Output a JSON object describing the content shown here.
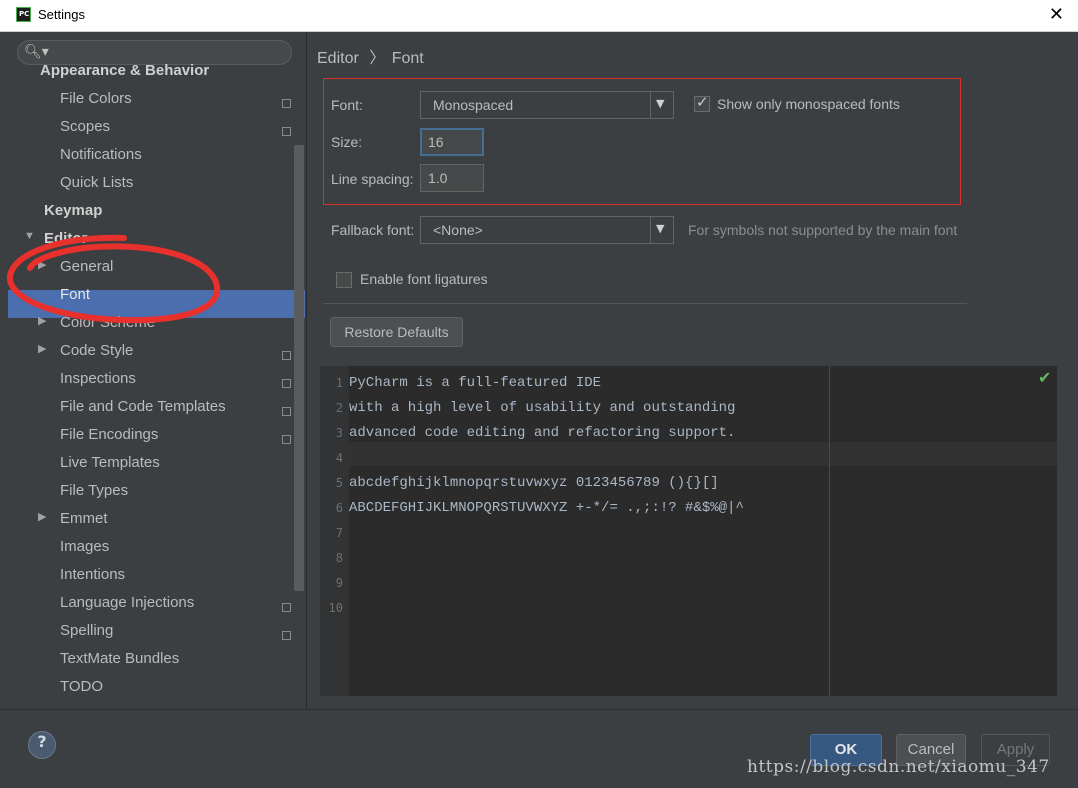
{
  "window": {
    "title": "Settings",
    "close_glyph": "✕",
    "app_icon": "PC"
  },
  "search": {
    "icon": "search-icon",
    "glyph": "🔍︎▾"
  },
  "tree": [
    {
      "label": "Appearance & Behavior",
      "kind": "category"
    },
    {
      "label": "File Colors",
      "kind": "item",
      "copy": true
    },
    {
      "label": "Scopes",
      "kind": "item",
      "copy": true
    },
    {
      "label": "Notifications",
      "kind": "item"
    },
    {
      "label": "Quick Lists",
      "kind": "item"
    },
    {
      "label": "Keymap",
      "kind": "category"
    },
    {
      "label": "Editor",
      "kind": "category",
      "expanded": true
    },
    {
      "label": "General",
      "kind": "item",
      "arrow": true
    },
    {
      "label": "Font",
      "kind": "item",
      "selected": true
    },
    {
      "label": "Color Scheme",
      "kind": "item",
      "arrow": true
    },
    {
      "label": "Code Style",
      "kind": "item",
      "arrow": true,
      "copy": true
    },
    {
      "label": "Inspections",
      "kind": "item",
      "copy": true
    },
    {
      "label": "File and Code Templates",
      "kind": "item",
      "copy": true
    },
    {
      "label": "File Encodings",
      "kind": "item",
      "copy": true
    },
    {
      "label": "Live Templates",
      "kind": "item"
    },
    {
      "label": "File Types",
      "kind": "item"
    },
    {
      "label": "Emmet",
      "kind": "item",
      "arrow": true
    },
    {
      "label": "Images",
      "kind": "item"
    },
    {
      "label": "Intentions",
      "kind": "item"
    },
    {
      "label": "Language Injections",
      "kind": "item",
      "copy": true
    },
    {
      "label": "Spelling",
      "kind": "item",
      "copy": true
    },
    {
      "label": "TextMate Bundles",
      "kind": "item"
    },
    {
      "label": "TODO",
      "kind": "item"
    }
  ],
  "breadcrumb": {
    "parent": "Editor",
    "sep": "〉",
    "current": "Font"
  },
  "font": {
    "font_label": "Font:",
    "font_value": "Monospaced",
    "mono_label": "Show only monospaced fonts",
    "mono_checked": "✓",
    "size_label": "Size:",
    "size_value": "16",
    "spacing_label": "Line spacing:",
    "spacing_value": "1.0",
    "fallback_label": "Fallback font:",
    "fallback_value": "<None>",
    "fallback_hint": "For symbols not supported by the main font",
    "ligatures_label": "Enable font ligatures",
    "restore_label": "Restore Defaults",
    "dropdown_glyph": "▼"
  },
  "preview": {
    "lines": [
      {
        "n": "1",
        "text": "PyCharm is a full-featured IDE"
      },
      {
        "n": "2",
        "text": "with a high level of usability and outstanding"
      },
      {
        "n": "3",
        "text": "advanced code editing and refactoring support."
      },
      {
        "n": "4",
        "text": ""
      },
      {
        "n": "5",
        "text": "abcdefghijklmnopqrstuvwxyz 0123456789 (){}[]"
      },
      {
        "n": "6",
        "text": "ABCDEFGHIJKLMNOPQRSTUVWXYZ +-*/= .,;:!? #&$%@|^"
      },
      {
        "n": "7",
        "text": ""
      },
      {
        "n": "8",
        "text": ""
      },
      {
        "n": "9",
        "text": ""
      },
      {
        "n": "10",
        "text": ""
      }
    ],
    "status_glyph": "✔"
  },
  "buttons": {
    "help": "?",
    "ok": "OK",
    "cancel": "Cancel",
    "apply": "Apply"
  },
  "watermark": "https://blog.csdn.net/xiaomu_347",
  "colors": {
    "selection": "#4b6eaf",
    "highlight": "#d9302c",
    "annotation": "#e8302c"
  }
}
